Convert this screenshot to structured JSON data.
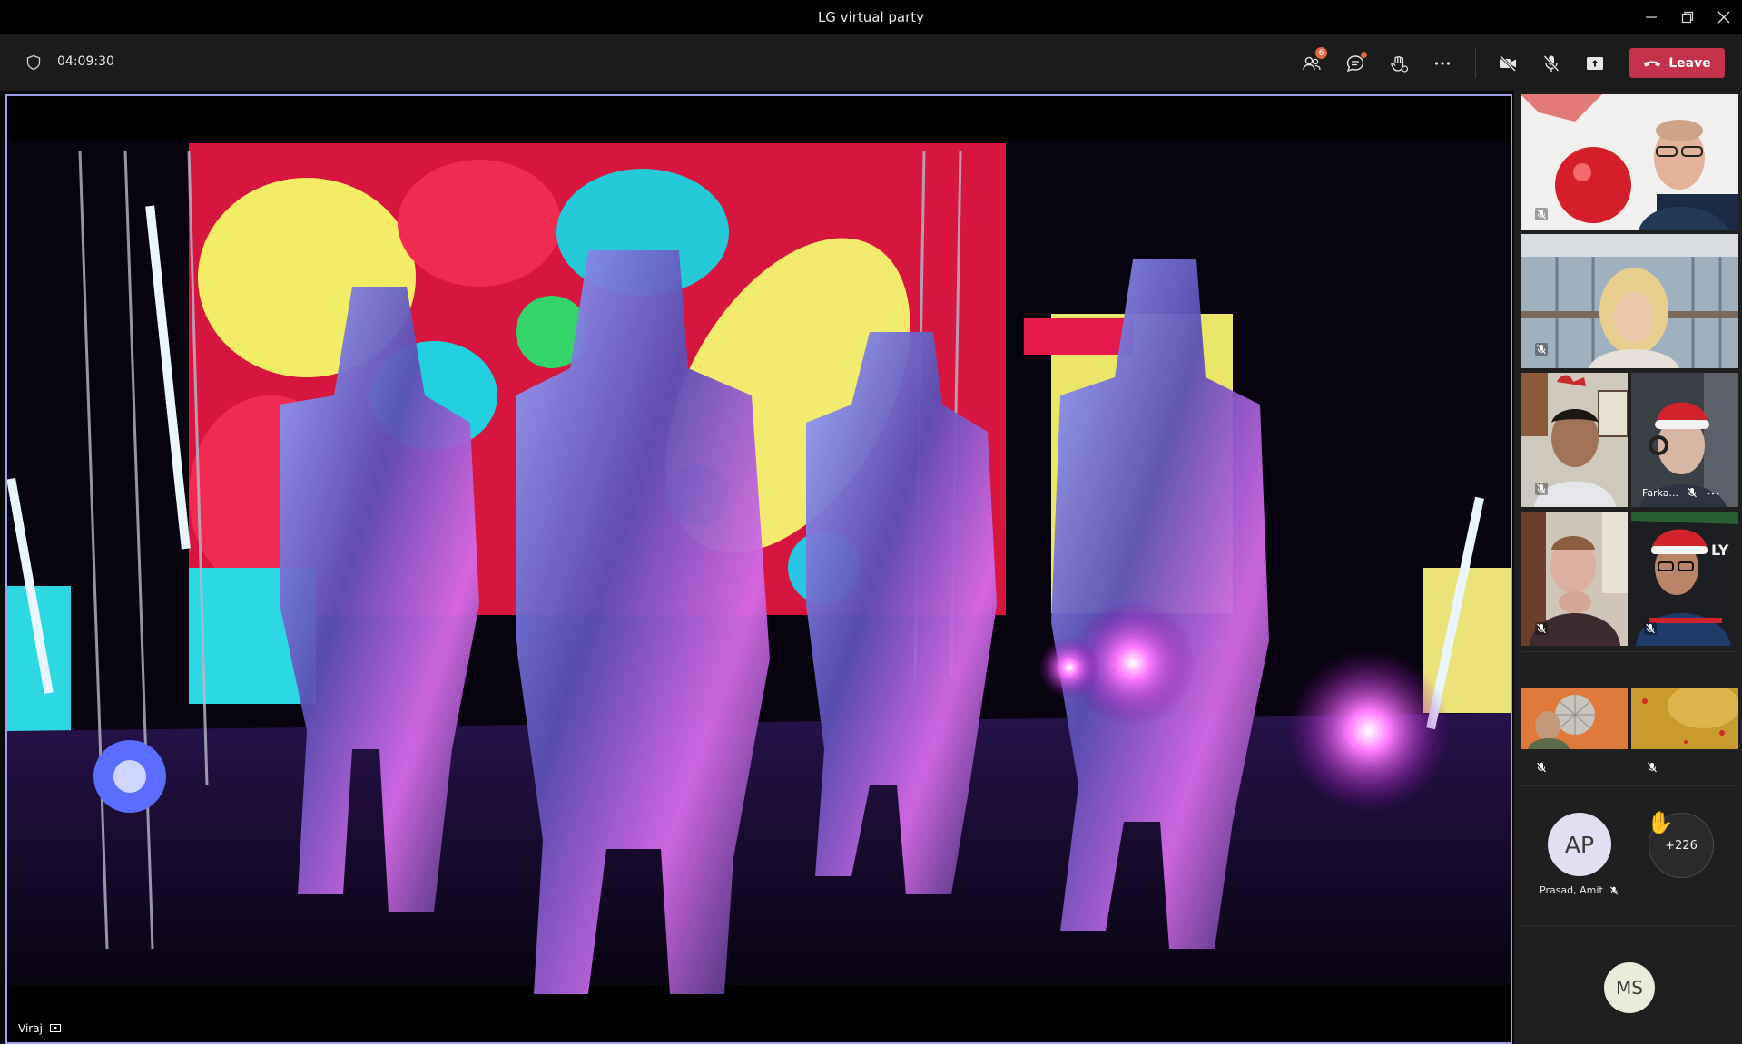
{
  "window": {
    "title": "LG virtual party"
  },
  "toolbar": {
    "timer": "04:09:30",
    "participants_badge": "6",
    "leave_label": "Leave"
  },
  "stage": {
    "presenter_name": "Viraj"
  },
  "gallery": {
    "tile_name_farka": "Farka...",
    "avatar_ap_initials": "AP",
    "avatar_ap_name": "Prasad, Amit",
    "overflow_count": "+226",
    "avatar_ms_initials": "MS"
  },
  "colors": {
    "leave": "#c4314b",
    "accent_border": "#9a9fe8",
    "badge": "#e0683f",
    "avatar_ap_bg": "#e3dff2",
    "avatar_ms_bg": "#e8ecd9"
  }
}
